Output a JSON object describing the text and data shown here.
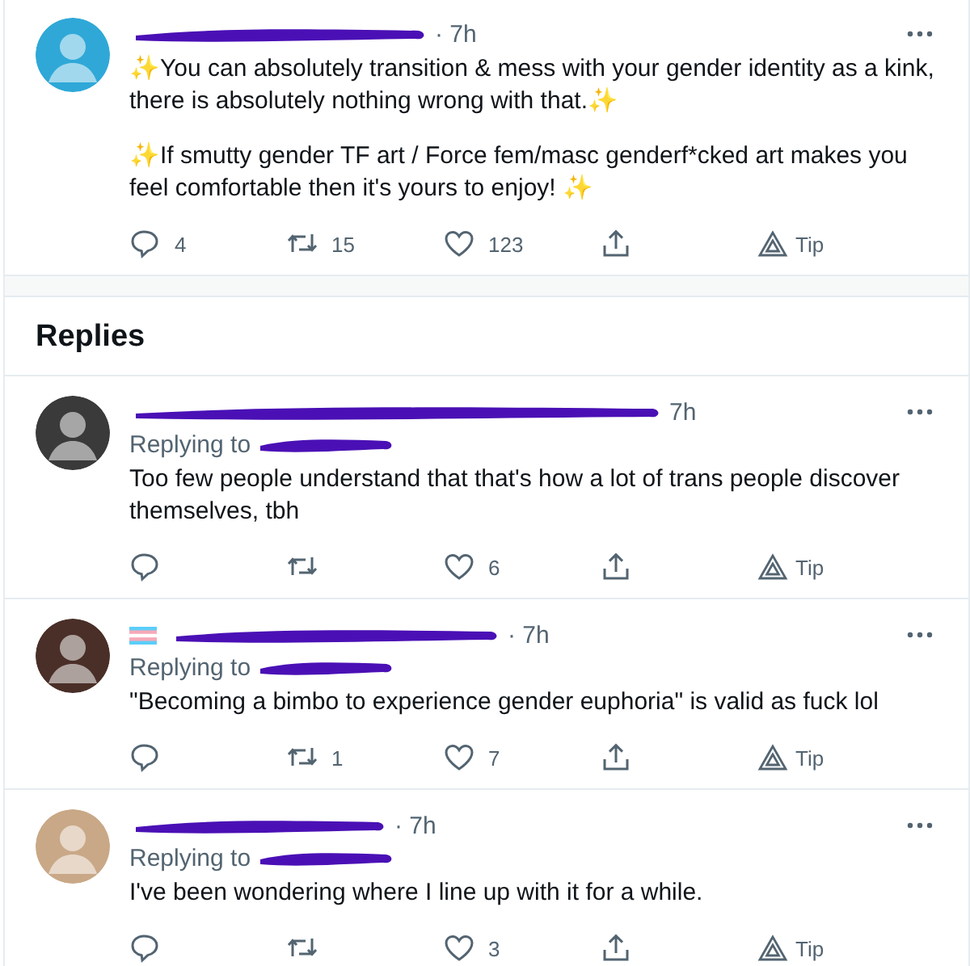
{
  "main_post": {
    "redacted": true,
    "flag_icon": false,
    "avatar": {
      "color": "#2fa8d8"
    },
    "time": "· 7h",
    "paragraphs": [
      "✨You can absolutely transition & mess with your gender identity as a kink, there is absolutely nothing wrong with that.✨",
      "✨If smutty gender TF art / Force fem/masc genderf*cked art makes you feel comfortable then it's yours to enjoy! ✨"
    ],
    "actions": [
      {
        "kind": "reply",
        "count": "4"
      },
      {
        "kind": "retweet",
        "count": "15"
      },
      {
        "kind": "like",
        "count": "123"
      },
      {
        "kind": "share"
      },
      {
        "kind": "tip",
        "label": "Tip"
      }
    ]
  },
  "replies_heading": "Replies",
  "replies": [
    {
      "redacted": true,
      "flag_icon": false,
      "avatar": {
        "color": "#3a3a3a"
      },
      "time": "7h",
      "replying_to": "Replying to",
      "paragraphs": [
        "Too few people understand that that's how a lot of trans people discover themselves, tbh"
      ],
      "actions": [
        {
          "kind": "reply"
        },
        {
          "kind": "retweet"
        },
        {
          "kind": "like",
          "count": "6"
        },
        {
          "kind": "share"
        },
        {
          "kind": "tip",
          "label": "Tip"
        }
      ]
    },
    {
      "redacted": true,
      "flag_icon": true,
      "avatar": {
        "color": "#4a2f28"
      },
      "time": "· 7h",
      "replying_to": "Replying to",
      "paragraphs": [
        "\"Becoming a bimbo to experience gender euphoria\" is valid as fuck lol"
      ],
      "actions": [
        {
          "kind": "reply"
        },
        {
          "kind": "retweet",
          "count": "1"
        },
        {
          "kind": "like",
          "count": "7"
        },
        {
          "kind": "share"
        },
        {
          "kind": "tip",
          "label": "Tip"
        }
      ]
    },
    {
      "redacted": true,
      "flag_icon": false,
      "avatar": {
        "color": "#c9a887"
      },
      "time": "· 7h",
      "replying_to": "Replying to",
      "paragraphs": [
        "I've been wondering where I line up with it for a while."
      ],
      "actions": [
        {
          "kind": "reply"
        },
        {
          "kind": "retweet"
        },
        {
          "kind": "like",
          "count": "3"
        },
        {
          "kind": "share"
        },
        {
          "kind": "tip",
          "label": "Tip"
        }
      ]
    }
  ]
}
